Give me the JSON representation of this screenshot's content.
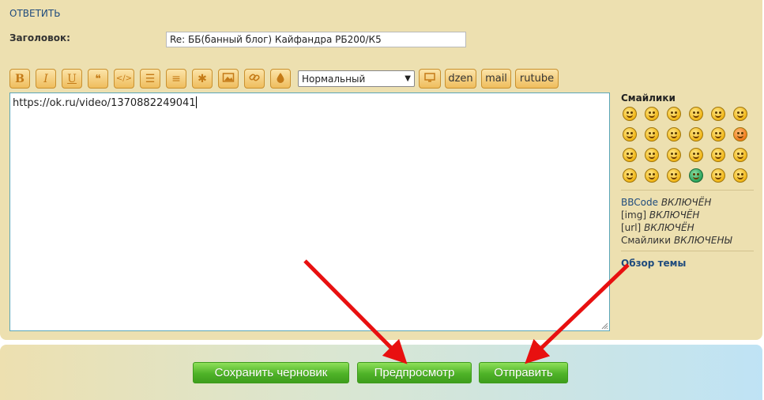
{
  "form": {
    "title": "ОТВЕТИТЬ",
    "subject_label": "Заголовок:",
    "subject_value": "Re: ББ(банный блог) Кайфандра РБ200/К5"
  },
  "toolbar": {
    "buttons": [
      {
        "name": "bold-button",
        "icon": "bold-icon",
        "glyph": "B"
      },
      {
        "name": "italic-button",
        "icon": "italic-icon",
        "glyph": "I"
      },
      {
        "name": "underline-button",
        "icon": "underline-icon",
        "glyph": "U"
      },
      {
        "name": "quote-button",
        "icon": "quote-icon",
        "glyph": "❝"
      },
      {
        "name": "code-button",
        "icon": "code-icon",
        "glyph": "</>"
      },
      {
        "name": "list-button",
        "icon": "list-icon",
        "glyph": "☰"
      },
      {
        "name": "ordered-list-button",
        "icon": "ordered-list-icon",
        "glyph": "≡"
      },
      {
        "name": "list-item-button",
        "icon": "asterisk-icon",
        "glyph": "✱"
      },
      {
        "name": "image-button",
        "icon": "image-icon",
        "glyph": "▭"
      },
      {
        "name": "link-button",
        "icon": "link-icon",
        "glyph": "∞"
      },
      {
        "name": "color-button",
        "icon": "drop-icon",
        "glyph": "●"
      }
    ],
    "font_size_selected": "Нормальный",
    "media_icon": "monitor-icon",
    "word_buttons": [
      "dzen",
      "mail",
      "rutube"
    ]
  },
  "editor": {
    "text": "https://ok.ru/video/1370882249041"
  },
  "sidebar": {
    "smilies_title": "Смайлики",
    "bbcode_link": "BBCode",
    "bbcode_state": "ВКЛЮЧЁН",
    "img_label": "[img]",
    "img_state": "ВКЛЮЧЁН",
    "url_label": "[url]",
    "url_state": "ВКЛЮЧЁН",
    "smilies_label": "Смайлики",
    "smilies_state": "ВКЛЮЧЕНЫ",
    "topic_review": "Обзор темы"
  },
  "actions": {
    "save_draft": "Сохранить черновик",
    "preview": "Предпросмотр",
    "submit": "Отправить"
  },
  "colors": {
    "panel": "#ede0b0",
    "link": "#1f4b7d",
    "button_green": "#4fb328",
    "arrow": "#e81010"
  }
}
